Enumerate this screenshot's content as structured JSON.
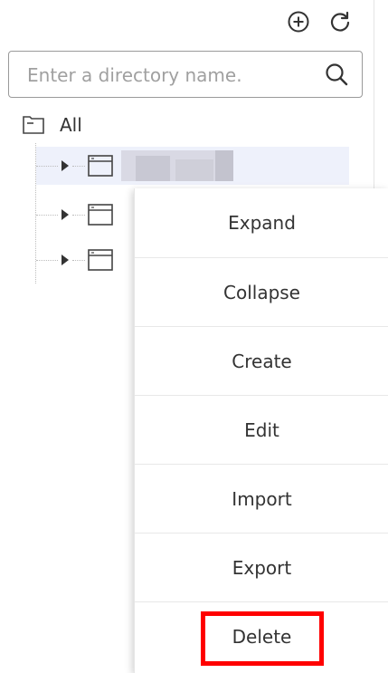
{
  "toolbar": {
    "add_icon": "circle-plus-icon",
    "refresh_icon": "refresh-icon"
  },
  "search": {
    "placeholder": "Enter a directory name.",
    "value": "",
    "icon": "search-icon"
  },
  "tree": {
    "root_label": "All",
    "root_icon": "folder-icon",
    "nodes": [
      {
        "label_redacted": true,
        "icon": "window-icon"
      },
      {
        "label_redacted": true,
        "icon": "window-icon"
      },
      {
        "label_redacted": true,
        "icon": "window-icon"
      }
    ]
  },
  "context_menu": {
    "items": [
      "Expand",
      "Collapse",
      "Create",
      "Edit",
      "Import",
      "Export",
      "Delete"
    ],
    "highlighted_item": "Delete",
    "highlight_color": "#ff0000"
  },
  "colors": {
    "selected_row": "#eef1fb",
    "text": "#333333"
  }
}
